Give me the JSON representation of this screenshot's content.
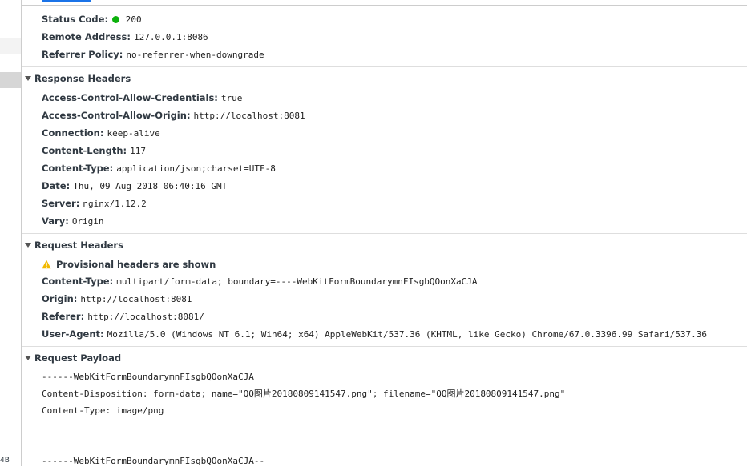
{
  "general": {
    "status_code_label": "Status Code:",
    "status_code_value": "200",
    "remote_address_label": "Remote Address:",
    "remote_address_value": "127.0.0.1:8086",
    "referrer_policy_label": "Referrer Policy:",
    "referrer_policy_value": "no-referrer-when-downgrade"
  },
  "response_headers": {
    "title": "Response Headers",
    "items": [
      {
        "key": "Access-Control-Allow-Credentials:",
        "value": "true"
      },
      {
        "key": "Access-Control-Allow-Origin:",
        "value": "http://localhost:8081"
      },
      {
        "key": "Connection:",
        "value": "keep-alive"
      },
      {
        "key": "Content-Length:",
        "value": "117"
      },
      {
        "key": "Content-Type:",
        "value": "application/json;charset=UTF-8"
      },
      {
        "key": "Date:",
        "value": "Thu, 09 Aug 2018 06:40:16 GMT"
      },
      {
        "key": "Server:",
        "value": "nginx/1.12.2"
      },
      {
        "key": "Vary:",
        "value": "Origin"
      }
    ]
  },
  "request_headers": {
    "title": "Request Headers",
    "warning": "Provisional headers are shown",
    "items": [
      {
        "key": "Content-Type:",
        "value": "multipart/form-data; boundary=----WebKitFormBoundarymnFIsgbQOonXaCJA"
      },
      {
        "key": "Origin:",
        "value": "http://localhost:8081"
      },
      {
        "key": "Referer:",
        "value": "http://localhost:8081/"
      },
      {
        "key": "User-Agent:",
        "value": "Mozilla/5.0 (Windows NT 6.1; Win64; x64) AppleWebKit/537.36 (KHTML, like Gecko) Chrome/67.0.3396.99 Safari/537.36"
      }
    ]
  },
  "request_payload": {
    "title": "Request Payload",
    "lines": [
      "------WebKitFormBoundarymnFIsgbQOonXaCJA",
      "Content-Disposition: form-data; name=\"QQ图片20180809141547.png\"; filename=\"QQ图片20180809141547.png\"",
      "Content-Type: image/png",
      "------WebKitFormBoundarymnFIsgbQOonXaCJA--"
    ]
  },
  "left_strip": {
    "bottom_text": "4B"
  },
  "colors": {
    "status_ok": "#0cb10c",
    "warning": "#f2b900",
    "selected_row": "#d6d6d6",
    "tab_accent": "#1a73e8"
  }
}
